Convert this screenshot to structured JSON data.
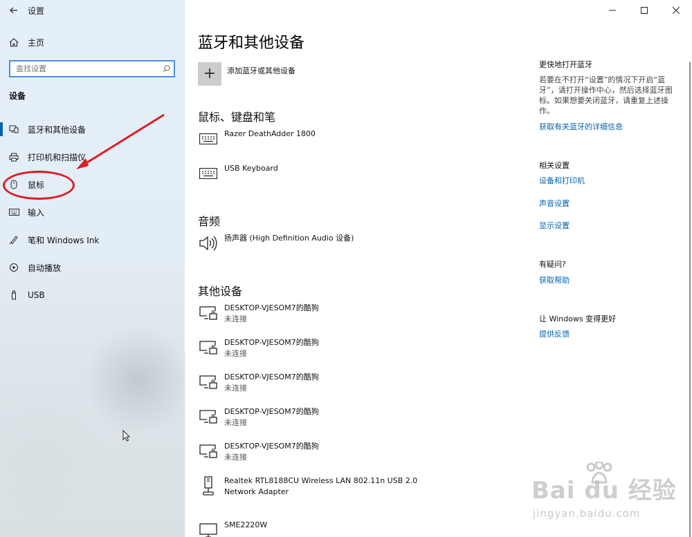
{
  "window": {
    "app_title": "设置",
    "back_icon": "back-arrow-icon",
    "controls": {
      "minimize": "—",
      "maximize": "☐",
      "close": "✕"
    }
  },
  "sidebar": {
    "home_label": "主页",
    "search_placeholder": "查找设置",
    "section_title": "设备",
    "items": [
      {
        "label": "蓝牙和其他设备",
        "icon": "bluetooth-devices-icon",
        "selected": true
      },
      {
        "label": "打印机和扫描仪",
        "icon": "printer-icon",
        "selected": false
      },
      {
        "label": "鼠标",
        "icon": "mouse-icon",
        "selected": false
      },
      {
        "label": "输入",
        "icon": "keyboard-icon",
        "selected": false
      },
      {
        "label": "笔和 Windows Ink",
        "icon": "pen-icon",
        "selected": false
      },
      {
        "label": "自动播放",
        "icon": "autoplay-icon",
        "selected": false
      },
      {
        "label": "USB",
        "icon": "usb-icon",
        "selected": false
      }
    ],
    "annotation_color": "#e01b22"
  },
  "main": {
    "page_title": "蓝牙和其他设备",
    "add_device_label": "添加蓝牙或其他设备",
    "groups": {
      "mouse_keyboard": {
        "title": "鼠标、键盘和笔",
        "devices": [
          {
            "name": "Razer DeathAdder 1800",
            "icon": "keyboard-icon"
          },
          {
            "name": "USB Keyboard",
            "icon": "keyboard-icon"
          }
        ]
      },
      "audio": {
        "title": "音频",
        "devices": [
          {
            "name": "扬声器 (High Definition Audio 设备)",
            "icon": "speaker-icon"
          }
        ]
      },
      "other": {
        "title": "其他设备",
        "devices": [
          {
            "name": "DESKTOP-VJESOM7的酷狗",
            "status": "未连接",
            "icon": "wireless-display-icon"
          },
          {
            "name": "DESKTOP-VJESOM7的酷狗",
            "status": "未连接",
            "icon": "wireless-display-icon"
          },
          {
            "name": "DESKTOP-VJESOM7的酷狗",
            "status": "未连接",
            "icon": "wireless-display-icon"
          },
          {
            "name": "DESKTOP-VJESOM7的酷狗",
            "status": "未连接",
            "icon": "wireless-display-icon"
          },
          {
            "name": "DESKTOP-VJESOM7的酷狗",
            "status": "未连接",
            "icon": "wireless-display-icon"
          },
          {
            "name": "Realtek RTL8188CU Wireless LAN 802.11n USB 2.0",
            "name2": "Network Adapter",
            "icon": "network-adapter-icon"
          },
          {
            "name": "SME2220W",
            "icon": "monitor-icon"
          }
        ]
      }
    }
  },
  "right_panel": {
    "bt_title": "更快地打开蓝牙",
    "bt_text": "若要在不打开“设置”的情况下开启“蓝牙”，请打开操作中心，然后选择蓝牙图标。如果想要关闭蓝牙，请重复上述操作。",
    "bt_link": "获取有关蓝牙的详细信息",
    "related_title": "相关设置",
    "related_links": [
      "设备和打印机",
      "声音设置",
      "显示设置"
    ],
    "help_title": "有疑问?",
    "help_link": "获取帮助",
    "feedback_title": "让 Windows 变得更好",
    "feedback_link": "提供反馈",
    "link_color": "#0063b1"
  },
  "watermark": {
    "main": "Bai du 经验",
    "sub": "jingyan.baidu.com"
  }
}
